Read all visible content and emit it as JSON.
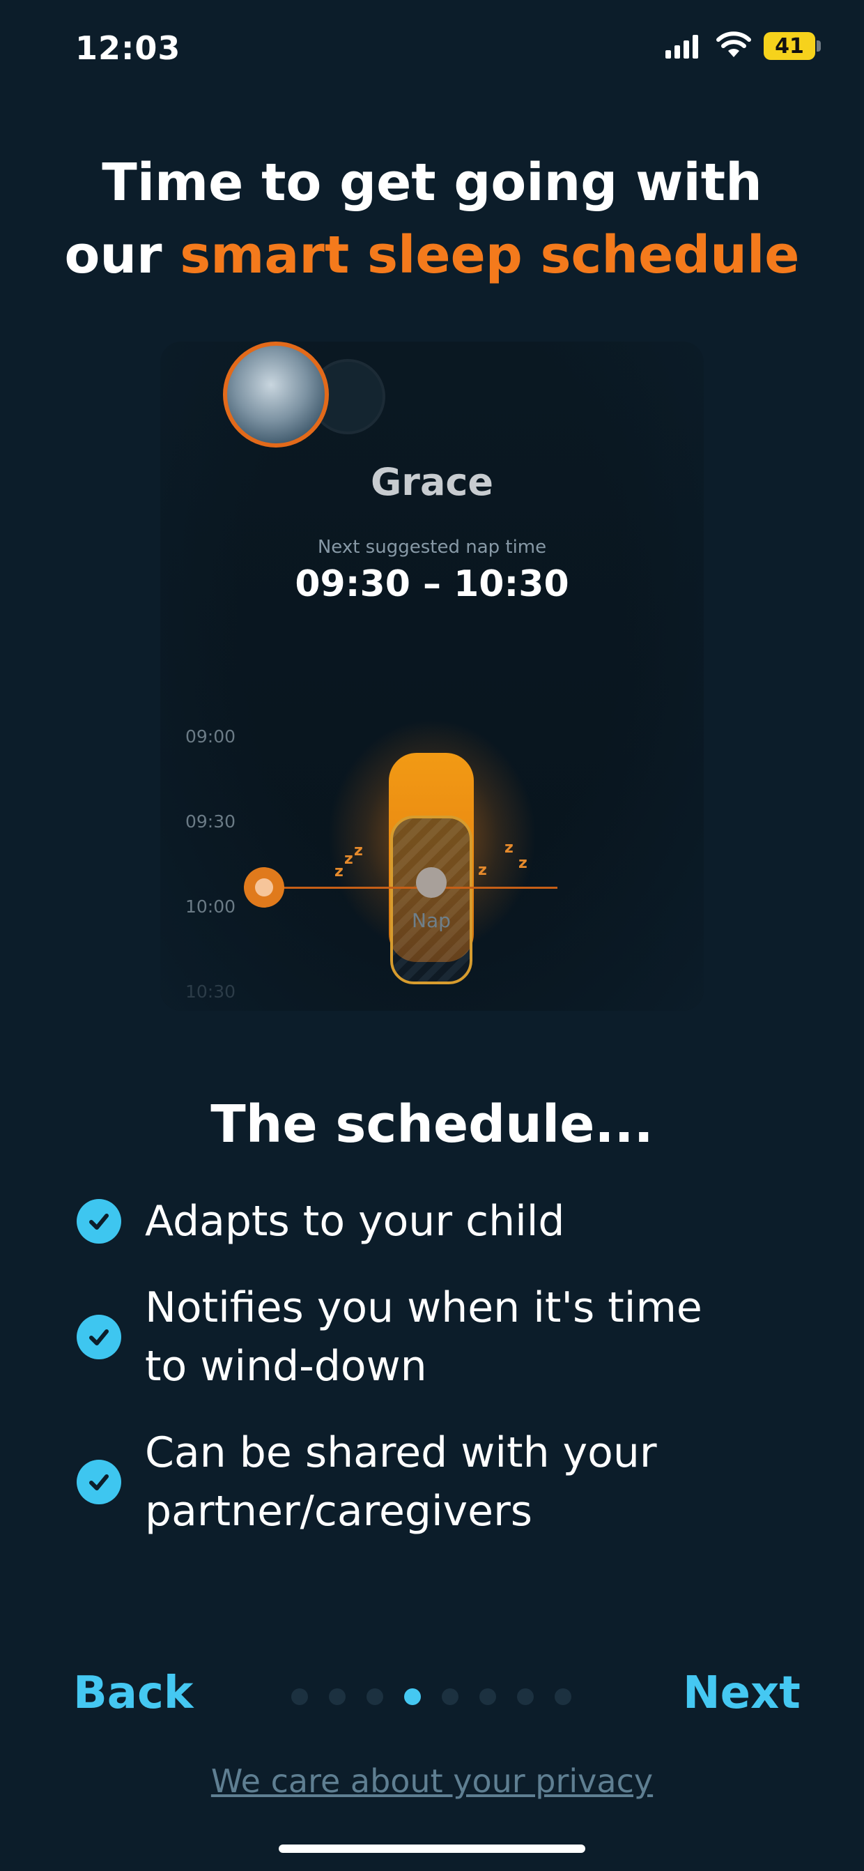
{
  "status_bar": {
    "time": "12:03",
    "battery": "41"
  },
  "headline": {
    "line1": "Time to get going with",
    "line2_prefix": "our ",
    "line2_accent": "smart sleep schedule"
  },
  "preview": {
    "child_name": "Grace",
    "nap_caption": "Next suggested nap time",
    "nap_range": "09:30 – 10:30",
    "time_labels": [
      "09:00",
      "09:30",
      "10:00",
      "10:30"
    ],
    "nap_label": "Nap"
  },
  "schedule": {
    "title": "The schedule...",
    "features": [
      [
        "Adapts to your child"
      ],
      [
        "Notifies you when it's time",
        "to wind-down"
      ],
      [
        "Can be shared with your",
        "partner/caregivers"
      ]
    ]
  },
  "nav": {
    "back": "Back",
    "next": "Next",
    "page_count": 8,
    "active_page": 4
  },
  "privacy_link": "We care about your privacy",
  "colors": {
    "background": "#0c1d2a",
    "accent_orange": "#f47a1c",
    "accent_blue": "#45c8f2"
  }
}
